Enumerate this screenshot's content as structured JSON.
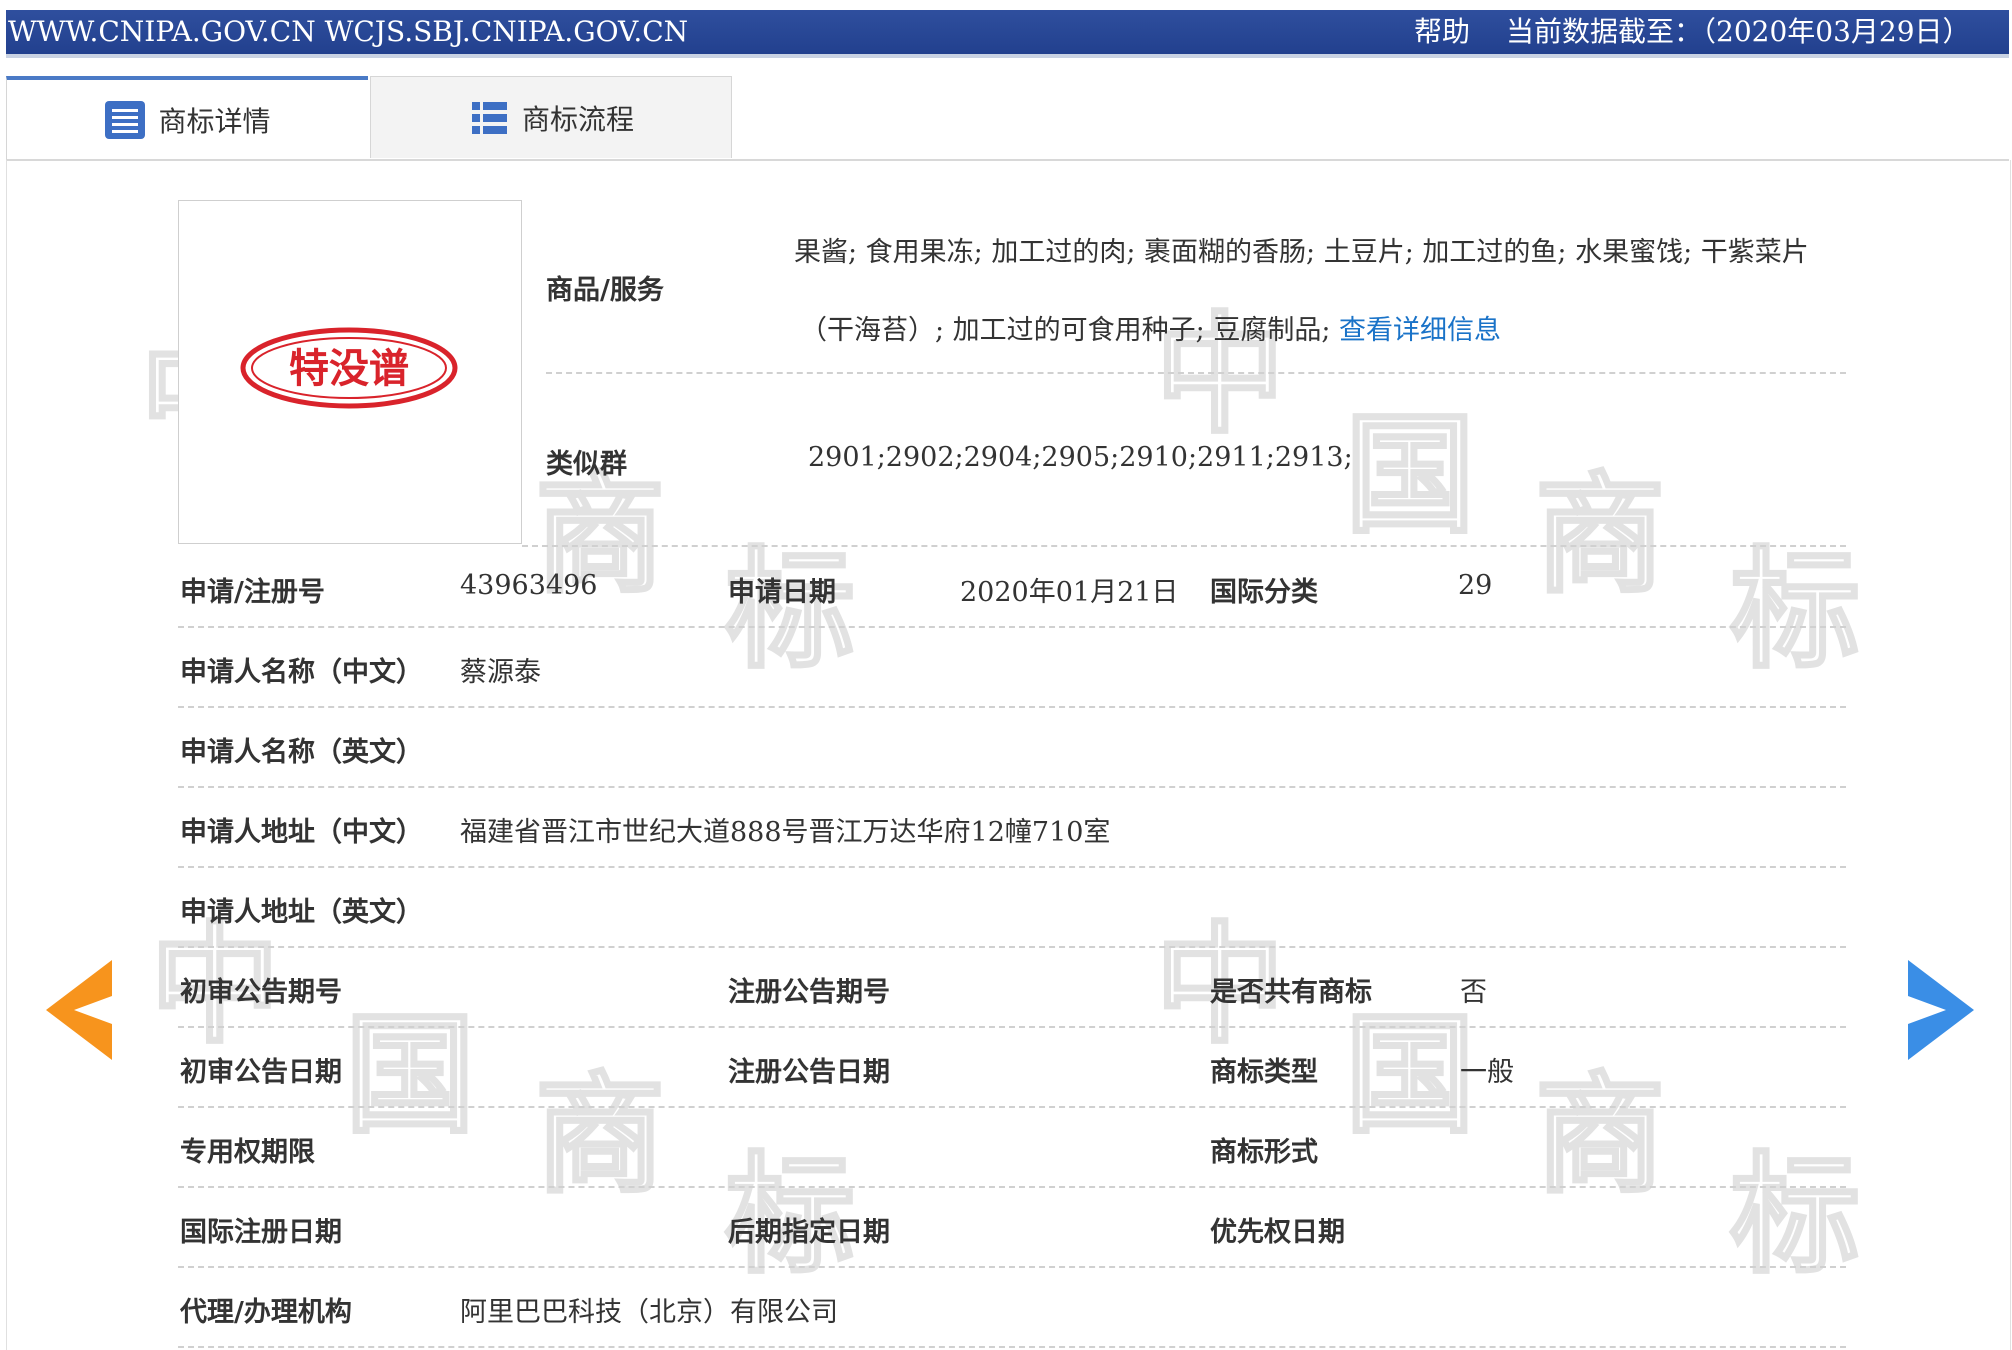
{
  "topbar": {
    "urls": "WWW.CNIPA.GOV.CN WCJS.SBJ.CNIPA.GOV.CN",
    "help": "帮助",
    "as_of": "当前数据截至：（2020年03月29日）"
  },
  "tabs": [
    {
      "label": "商标详情",
      "icon": "document-list-icon",
      "active": true
    },
    {
      "label": "商标流程",
      "icon": "process-list-icon",
      "active": false
    }
  ],
  "logo": {
    "text": "特没谱",
    "color": "#d9232b"
  },
  "watermark": {
    "chars": [
      "中",
      "国",
      "商",
      "标"
    ]
  },
  "goods": {
    "label": "商品/服务",
    "line1": "果酱; 食用果冻; 加工过的肉; 裹面糊的香肠; 土豆片; 加工过的鱼; 水果蜜饯; 干紫菜片",
    "line2": "（干海苔）; 加工过的可食用种子; 豆腐制品; ",
    "link": "查看详细信息"
  },
  "similar": {
    "label": "类似群",
    "value": "2901;2902;2904;2905;2910;2911;2913;"
  },
  "fields": {
    "reg_no": {
      "label": "申请/注册号",
      "value": "43963496"
    },
    "app_date": {
      "label": "申请日期",
      "value": "2020年01月21日"
    },
    "intl_class": {
      "label": "国际分类",
      "value": "29"
    },
    "applicant_cn": {
      "label": "申请人名称（中文）",
      "value": "蔡源泰"
    },
    "applicant_en": {
      "label": "申请人名称（英文）",
      "value": ""
    },
    "address_cn": {
      "label": "申请人地址（中文）",
      "value": "福建省晋江市世纪大道888号晋江万达华府12幢710室"
    },
    "address_en": {
      "label": "申请人地址（英文）",
      "value": ""
    },
    "prelim_issue": {
      "label": "初审公告期号",
      "value": ""
    },
    "reg_issue": {
      "label": "注册公告期号",
      "value": ""
    },
    "shared": {
      "label": "是否共有商标",
      "value": "否"
    },
    "prelim_date": {
      "label": "初审公告日期",
      "value": ""
    },
    "reg_date": {
      "label": "注册公告日期",
      "value": ""
    },
    "mark_type": {
      "label": "商标类型",
      "value": "一般"
    },
    "exclusive_period": {
      "label": "专用权期限",
      "value": ""
    },
    "mark_form": {
      "label": "商标形式",
      "value": ""
    },
    "intl_reg_date": {
      "label": "国际注册日期",
      "value": ""
    },
    "later_designation": {
      "label": "后期指定日期",
      "value": ""
    },
    "priority_date": {
      "label": "优先权日期",
      "value": ""
    },
    "agent": {
      "label": "代理/办理机构",
      "value": "阿里巴巴科技（北京）有限公司"
    }
  },
  "nav": {
    "prev_color": "#f7941d",
    "next_color": "#3a8ee6"
  }
}
